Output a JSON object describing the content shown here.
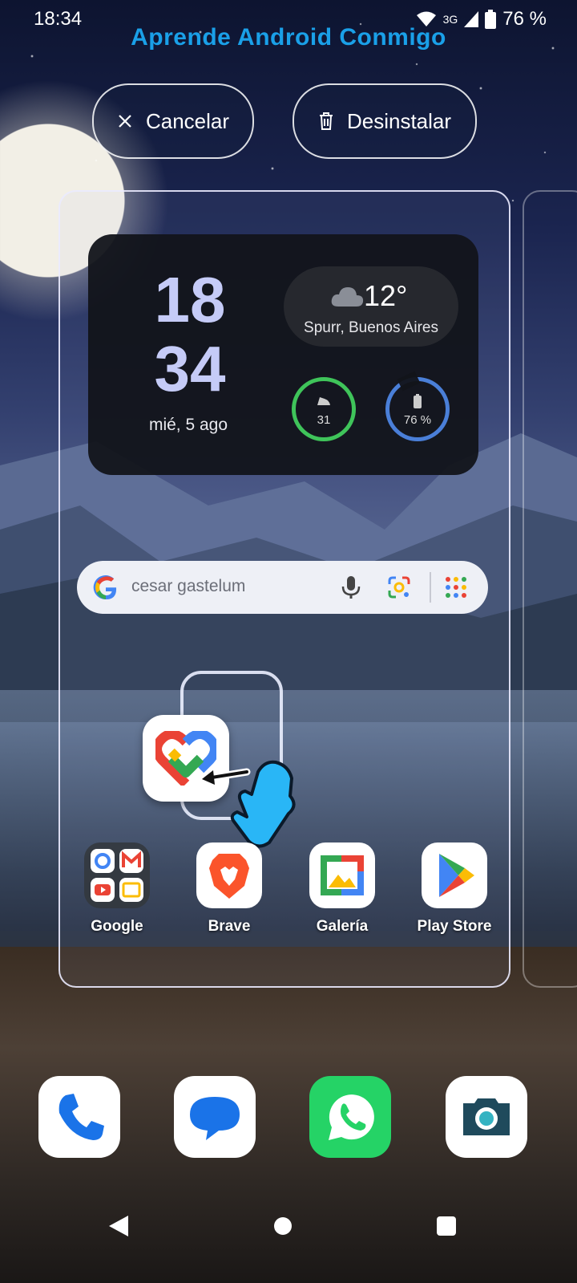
{
  "status_bar": {
    "time": "18:34",
    "network": "3G",
    "battery": "76 %"
  },
  "watermark": "Aprende Android Conmigo",
  "edit_bar": {
    "cancel_label": "Cancelar",
    "uninstall_label": "Desinstalar"
  },
  "widget": {
    "hour": "18",
    "minute": "34",
    "date": "mié, 5 ago",
    "temperature": "12°",
    "location": "Spurr, Buenos Aires",
    "steps_value": "31",
    "battery_value": "76 %"
  },
  "search": {
    "query": "cesar gastelum"
  },
  "dragged_app": {
    "icon": "google-fit-icon"
  },
  "apps": [
    {
      "label": "Google",
      "icon": "google-folder-icon"
    },
    {
      "label": "Brave",
      "icon": "brave-icon"
    },
    {
      "label": "Galería",
      "icon": "gallery-icon"
    },
    {
      "label": "Play Store",
      "icon": "play-store-icon"
    }
  ],
  "dock": [
    {
      "icon": "phone-icon"
    },
    {
      "icon": "messages-icon"
    },
    {
      "icon": "whatsapp-icon"
    },
    {
      "icon": "camera-icon"
    }
  ],
  "colors": {
    "accent": "#1aa0e8",
    "widget_bg": "#121419",
    "clock": "#c5cbf7",
    "ring_green": "#3fc45a",
    "ring_blue": "#4a7fd8"
  }
}
